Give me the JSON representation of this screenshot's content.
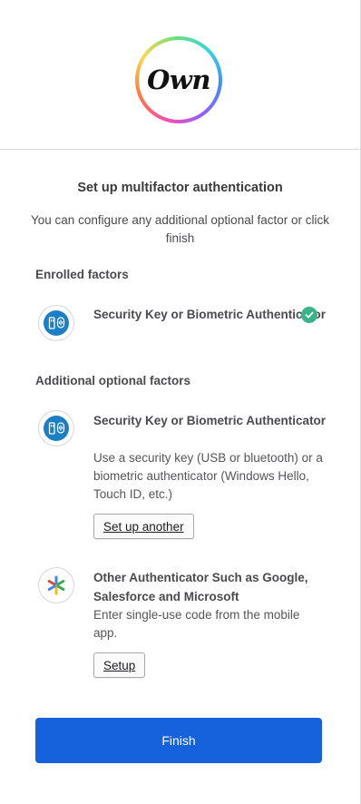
{
  "brand": {
    "logo_text": "Own"
  },
  "page": {
    "title": "Set up multifactor authentication",
    "subtitle": "You can configure any additional optional factor or click finish"
  },
  "enrolled": {
    "heading": "Enrolled factors",
    "items": [
      {
        "title": "Security Key or Biometric Authenticator",
        "icon": "security-key-icon",
        "status_icon": "check-circle-icon"
      }
    ]
  },
  "additional": {
    "heading": "Additional optional factors",
    "items": [
      {
        "title": "Security Key or Biometric Authenticator",
        "description": "Use a security key (USB or bluetooth) or a biometric authenticator (Windows Hello, Touch ID, etc.)",
        "button": "Set up another",
        "icon": "security-key-icon"
      },
      {
        "title": "Other Authenticator Such as Google, Salesforce and Microsoft",
        "description": "Enter single-use code from the mobile app.",
        "button": "Setup",
        "icon": "google-authenticator-icon"
      }
    ]
  },
  "finish_button": "Finish",
  "colors": {
    "primary": "#1662dd",
    "success": "#3bb38a"
  }
}
